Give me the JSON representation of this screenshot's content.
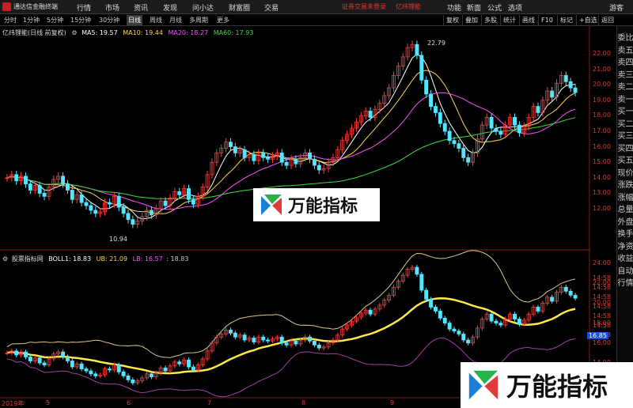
{
  "app": {
    "name": "通达信金融终端"
  },
  "menu": [
    "行情",
    "市场",
    "资讯",
    "发现",
    "问小达",
    "财富圈",
    "交易"
  ],
  "notice": "证券交易未登录",
  "notice2": "亿纬锂能",
  "top_right": [
    "功能",
    "新面",
    "公式",
    "选项",
    "游客"
  ],
  "periods": [
    "分时",
    "1分钟",
    "5分钟",
    "15分钟",
    "30分钟",
    "日线",
    "周线",
    "月线",
    "多周期",
    "更多"
  ],
  "active_period": "日线",
  "toolbar_buttons": [
    "复权",
    "叠加",
    "多股",
    "统计",
    "画线",
    "F10",
    "标记",
    "+自选",
    "返回"
  ],
  "main_legend": {
    "title": "亿纬锂能(日线 前复权)",
    "ma5": "MA5: 19.57",
    "ma10": "MA10: 19.44",
    "ma20": "MA20: 18.27",
    "ma60": "MA60: 17.93"
  },
  "sub_legend": {
    "title": "股票指标网",
    "boll": "BOLL1: 18.83",
    "ub": "UB: 21.09",
    "lb": "LB: 16.57",
    "extra": ": 18.83"
  },
  "annotations": {
    "high": "22.79",
    "low": "10.94"
  },
  "price_axis": [
    "22.00",
    "21.00",
    "20.00",
    "19.00",
    "18.00",
    "17.00",
    "16.00",
    "15.00",
    "14.00",
    "13.00",
    "12.00"
  ],
  "sub_axis": [
    "24.00",
    "22.00",
    "20.00",
    "18.00",
    "16.00",
    "14.00"
  ],
  "sub_axis_current": "16.85",
  "sub_time_labels": [
    "14:58",
    "14:58",
    "14:58",
    "14:58",
    "14:58",
    "14:58",
    "14:58"
  ],
  "date_labels": [
    "2019年",
    "5",
    "6",
    "7",
    "8",
    "9"
  ],
  "side_panel": [
    "委比",
    "卖五",
    "卖四",
    "卖三",
    "卖二",
    "卖一",
    "买一",
    "买二",
    "买三",
    "买四",
    "买五",
    "现价",
    "涨跌",
    "涨幅",
    "总量",
    "外盘",
    "换手",
    "净资",
    "收益",
    "自动",
    "行情"
  ],
  "watermark": "万能指标",
  "colors": {
    "up": "#ff3c3c",
    "down": "#54e6ff",
    "ma5": "#ffffff",
    "ma10": "#ffd84a",
    "ma20": "#ff4fff",
    "ma60": "#3fdc3f"
  }
}
